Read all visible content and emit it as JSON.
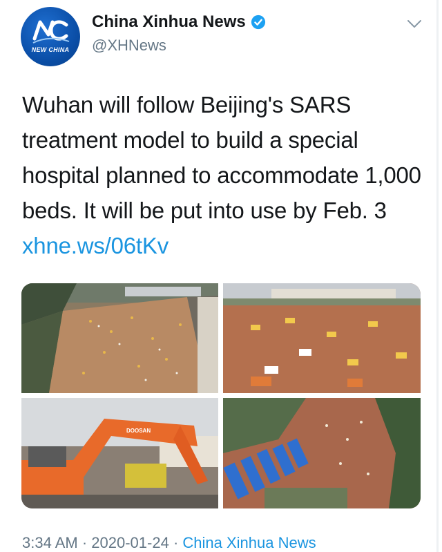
{
  "account": {
    "display_name": "China Xinhua News",
    "handle": "@XHNews",
    "avatar_caption": "NEW CHINA",
    "verified": true
  },
  "tweet": {
    "text": "Wuhan will follow Beijing's SARS treatment model to build a special hospital planned to accommodate 1,000 beds. It will be put into use by Feb. 3 ",
    "link": "xhne.ws/06tKv"
  },
  "media": {
    "count": 4,
    "items": [
      {
        "label": "aerial-construction-site-1"
      },
      {
        "label": "excavators-site-2"
      },
      {
        "label": "doosan-excavator"
      },
      {
        "label": "aerial-site-with-blue-roofs"
      }
    ],
    "excavator_brand": "DOOSAN"
  },
  "footer": {
    "time": "3:34 AM",
    "separator": " · ",
    "date": "2020-01-24",
    "source": "China Xinhua News"
  },
  "colors": {
    "link": "#1b95e0",
    "text": "#14171a",
    "secondary": "#657786",
    "verified": "#1da1f2"
  },
  "icons": [
    "verified-badge-icon",
    "chevron-down-icon"
  ]
}
